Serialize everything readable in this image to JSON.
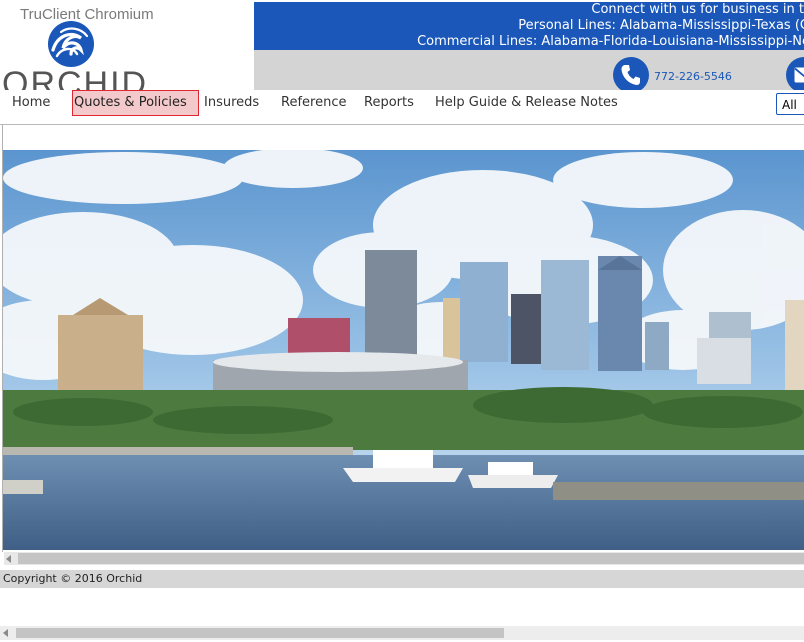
{
  "app": {
    "title": "TruClient Chromium"
  },
  "logo": {
    "text": "ORCHID",
    "color": "#1a57b8"
  },
  "banner": {
    "line1": "Connect with us for business in t",
    "line2": "Personal Lines: Alabama-Mississippi-Texas (G",
    "line3": "Commercial Lines: Alabama-Florida-Louisiana-Mississippi-Ne",
    "background": "#1a57b8"
  },
  "contact": {
    "phone_icon": "phone-icon",
    "phone": "772-226-5546",
    "mail_icon": "mail-icon"
  },
  "nav": {
    "items": [
      {
        "label": "Home",
        "active": false
      },
      {
        "label": "Quotes & Policies",
        "active": true
      },
      {
        "label": "Insureds",
        "active": false
      },
      {
        "label": "Reference",
        "active": false
      },
      {
        "label": "Reports",
        "active": false
      },
      {
        "label": "Help Guide & Release Notes",
        "active": false
      }
    ],
    "select_value": "All"
  },
  "hero": {
    "image": "tampa-skyline-photo"
  },
  "footer": {
    "copyright": "Copyright © 2016 Orchid"
  }
}
